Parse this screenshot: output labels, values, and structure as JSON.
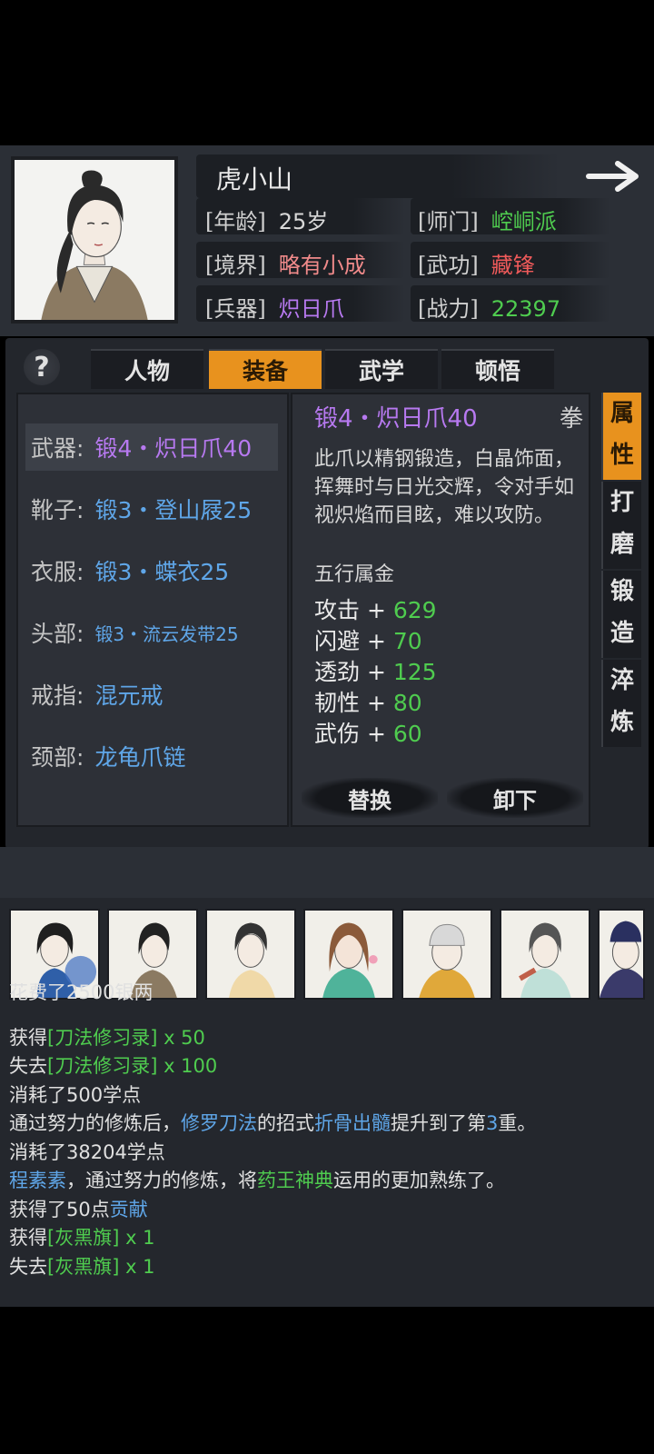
{
  "character": {
    "name": "虎小山",
    "attrs": [
      {
        "label": "[年龄]",
        "value": "25岁",
        "color": "#d8d8d8"
      },
      {
        "label": "[师门]",
        "value": "崆峒派",
        "color": "#4fcc4f"
      },
      {
        "label": "[境界]",
        "value": "略有小成",
        "color": "#f08a8a"
      },
      {
        "label": "[武功]",
        "value": "藏锋",
        "color": "#ef5a5a"
      },
      {
        "label": "[兵器]",
        "value": "炽日爪",
        "color": "#b779f0"
      },
      {
        "label": "[战力]",
        "value": "22397",
        "color": "#4fcc4f"
      }
    ]
  },
  "tabs": [
    "人物",
    "装备",
    "武学",
    "顿悟"
  ],
  "active_tab": "装备",
  "help_label": "?",
  "equipment": [
    {
      "slot": "武器:",
      "item": "锻4・炽日爪40",
      "color": "#b779f0",
      "selected": true
    },
    {
      "slot": "靴子:",
      "item": "锻3・登山屐25",
      "color": "#5fa6e8"
    },
    {
      "slot": "衣服:",
      "item": "锻3・蝶衣25",
      "color": "#5fa6e8"
    },
    {
      "slot": "头部:",
      "item": "锻3・流云发带25",
      "color": "#5fa6e8",
      "small": true
    },
    {
      "slot": "戒指:",
      "item": "混元戒",
      "color": "#5fa6e8"
    },
    {
      "slot": "颈部:",
      "item": "龙龟爪链",
      "color": "#5fa6e8"
    }
  ],
  "detail": {
    "title": "锻4・炽日爪40",
    "type": "拳",
    "description": "此爪以精钢锻造，白晶饰面，挥舞时与日光交辉，令对手如视炽焰而目眩，难以攻防。",
    "element": "五行属金",
    "stats": [
      {
        "name": "攻击",
        "value": "629"
      },
      {
        "name": "闪避",
        "value": "70"
      },
      {
        "name": "透劲",
        "value": "125"
      },
      {
        "name": "韧性",
        "value": "80"
      },
      {
        "name": "武伤",
        "value": "60"
      }
    ],
    "replace_label": "替换",
    "unequip_label": "卸下"
  },
  "side_tabs": [
    "属性",
    "打磨",
    "锻造",
    "淬炼"
  ],
  "log": [
    {
      "parts": [
        {
          "t": "花费了2500银两"
        }
      ]
    },
    {
      "parts": [
        {
          "t": "获得"
        },
        {
          "t": "[刀法修习录]",
          "c": "green"
        },
        {
          "t": " x 50",
          "c": "green"
        }
      ]
    },
    {
      "parts": [
        {
          "t": "失去"
        },
        {
          "t": "[刀法修习录]",
          "c": "green"
        },
        {
          "t": " x 100",
          "c": "green"
        }
      ]
    },
    {
      "parts": [
        {
          "t": "消耗了500学点"
        }
      ]
    },
    {
      "parts": [
        {
          "t": "通过努力的修炼后，"
        },
        {
          "t": "修罗刀法",
          "c": "blue"
        },
        {
          "t": "的招式"
        },
        {
          "t": "折骨出髓",
          "c": "blue"
        },
        {
          "t": "提升到了第"
        },
        {
          "t": "3",
          "c": "blue"
        },
        {
          "t": "重。"
        }
      ]
    },
    {
      "parts": [
        {
          "t": "消耗了38204学点"
        }
      ]
    },
    {
      "parts": [
        {
          "t": "程素素",
          "c": "blue"
        },
        {
          "t": "，通过努力的修炼，将"
        },
        {
          "t": "药王神典",
          "c": "green"
        },
        {
          "t": "运用的更加熟练了。"
        }
      ]
    },
    {
      "parts": [
        {
          "t": "获得了50点"
        },
        {
          "t": "贡献",
          "c": "blue"
        }
      ]
    },
    {
      "parts": [
        {
          "t": "获得"
        },
        {
          "t": "[灰黑旗]",
          "c": "green"
        },
        {
          "t": " x 1",
          "c": "green"
        }
      ]
    },
    {
      "parts": [
        {
          "t": "失去"
        },
        {
          "t": "[灰黑旗]",
          "c": "green"
        },
        {
          "t": " x 1",
          "c": "green"
        }
      ]
    }
  ],
  "colors": {
    "accent": "#e8921e",
    "green": "#4fcc4f",
    "blue": "#5fa6e8",
    "purple": "#b779f0"
  }
}
